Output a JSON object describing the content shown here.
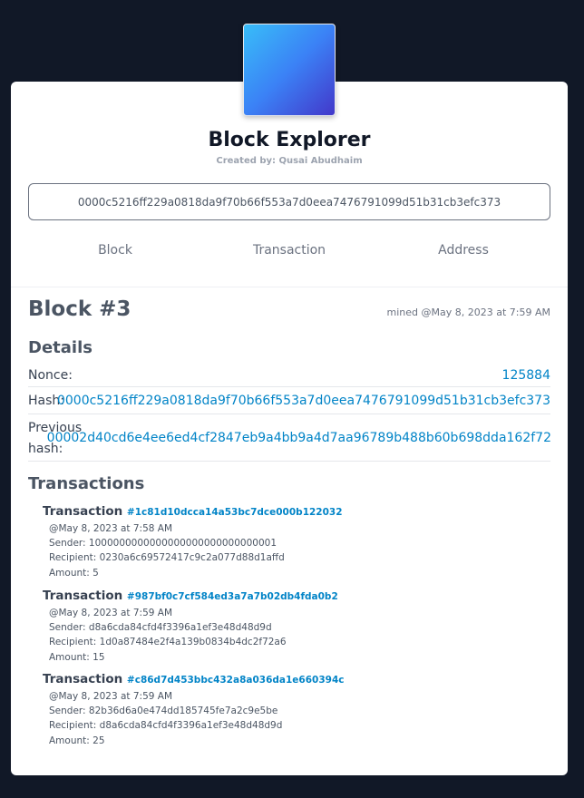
{
  "header": {
    "title": "Block Explorer",
    "subtitle": "Created by: Qusai Abudhaim"
  },
  "search": {
    "value": "0000c5216ff229a0818da9f70b66f553a7d0eea7476791099d51b31cb3efc373"
  },
  "tabs": [
    {
      "label": "Block"
    },
    {
      "label": "Transaction"
    },
    {
      "label": "Address"
    }
  ],
  "block": {
    "title": "Block #3",
    "mined": "mined @May 8, 2023 at 7:59 AM",
    "details_heading": "Details",
    "nonce_label": "Nonce:",
    "nonce": "125884",
    "hash_label": "Hash:",
    "hash": "0000c5216ff229a0818da9f70b66f553a7d0eea7476791099d51b31cb3efc373",
    "prev_label_line1": "Previous",
    "prev_label_line2": "hash:",
    "previous_hash": "00002d40cd6e4ee6ed4cf2847eb9a4bb9a4d7aa96789b488b60b698dda162f72"
  },
  "transactions_heading": "Transactions",
  "transactions": [
    {
      "label": "Transaction",
      "hash": "#1c81d10dcca14a53bc7dce000b122032",
      "time": "@May 8, 2023 at 7:58 AM",
      "sender": "Sender: 1000000000000000000000000000001",
      "recipient": "Recipient: 0230a6c69572417c9c2a077d88d1affd",
      "amount": "Amount: 5"
    },
    {
      "label": "Transaction",
      "hash": "#987bf0c7cf584ed3a7a7b02db4fda0b2",
      "time": "@May 8, 2023 at 7:59 AM",
      "sender": "Sender: d8a6cda84cfd4f3396a1ef3e48d48d9d",
      "recipient": "Recipient: 1d0a87484e2f4a139b0834b4dc2f72a6",
      "amount": "Amount: 15"
    },
    {
      "label": "Transaction",
      "hash": "#c86d7d453bbc432a8a036da1e660394c",
      "time": "@May 8, 2023 at 7:59 AM",
      "sender": "Sender: 82b36d6a0e474dd185745fe7a2c9e5be",
      "recipient": "Recipient: d8a6cda84cfd4f3396a1ef3e48d48d9d",
      "amount": "Amount: 25"
    }
  ],
  "colors": {
    "background": "#111827",
    "link": "#0284c7",
    "logo_gradient_start": "#38bdf8",
    "logo_gradient_end": "#4338ca"
  }
}
